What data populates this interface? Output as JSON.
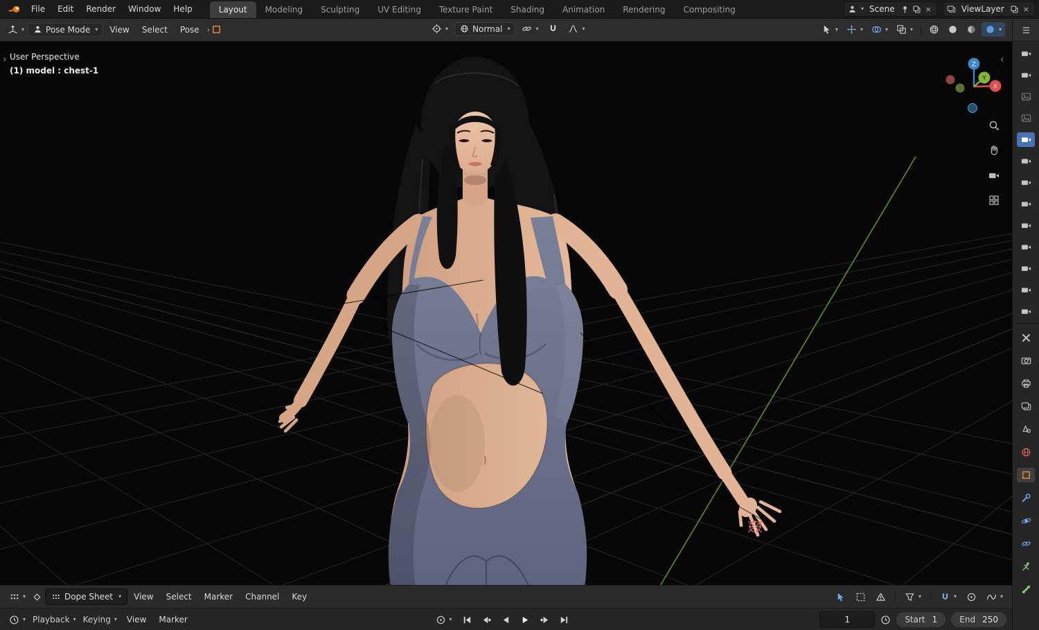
{
  "glyphs": {
    "chevron_down": "▾",
    "chevron_right": "›",
    "chevron_left": "‹",
    "close": "×"
  },
  "topbar": {
    "menus": [
      "File",
      "Edit",
      "Render",
      "Window",
      "Help"
    ],
    "tabs": [
      "Layout",
      "Modeling",
      "Sculpting",
      "UV Editing",
      "Texture Paint",
      "Shading",
      "Animation",
      "Rendering",
      "Compositing"
    ],
    "active_tab": "Layout",
    "scene_value": "Scene",
    "viewlayer_value": "ViewLayer"
  },
  "viewport_header": {
    "mode": "Pose Mode",
    "menus": [
      "View",
      "Select",
      "Pose"
    ],
    "orientation": "Normal"
  },
  "viewport": {
    "overlay": {
      "line1": "User Perspective",
      "line2": "(1) model : chest-1"
    },
    "gizmo": {
      "x": "X",
      "y": "Y",
      "z": "Z"
    }
  },
  "dopesheet": {
    "editor_label": "Dope Sheet",
    "menus": [
      "View",
      "Select",
      "Marker",
      "Channel",
      "Key"
    ]
  },
  "timeline": {
    "playback_label": "Playback",
    "keying_label": "Keying",
    "menus": [
      "View",
      "Marker"
    ],
    "frame_current": "1",
    "start_label": "Start",
    "start_value": "1",
    "end_label": "End",
    "end_value": "250"
  },
  "colors": {
    "accent": "#4772b3",
    "object_orange": "#e0883a",
    "axis_x": "#dd4e4e",
    "axis_y": "#84b33c",
    "axis_z": "#3f86c7",
    "floor_axis_green": "#5d8f2b"
  }
}
